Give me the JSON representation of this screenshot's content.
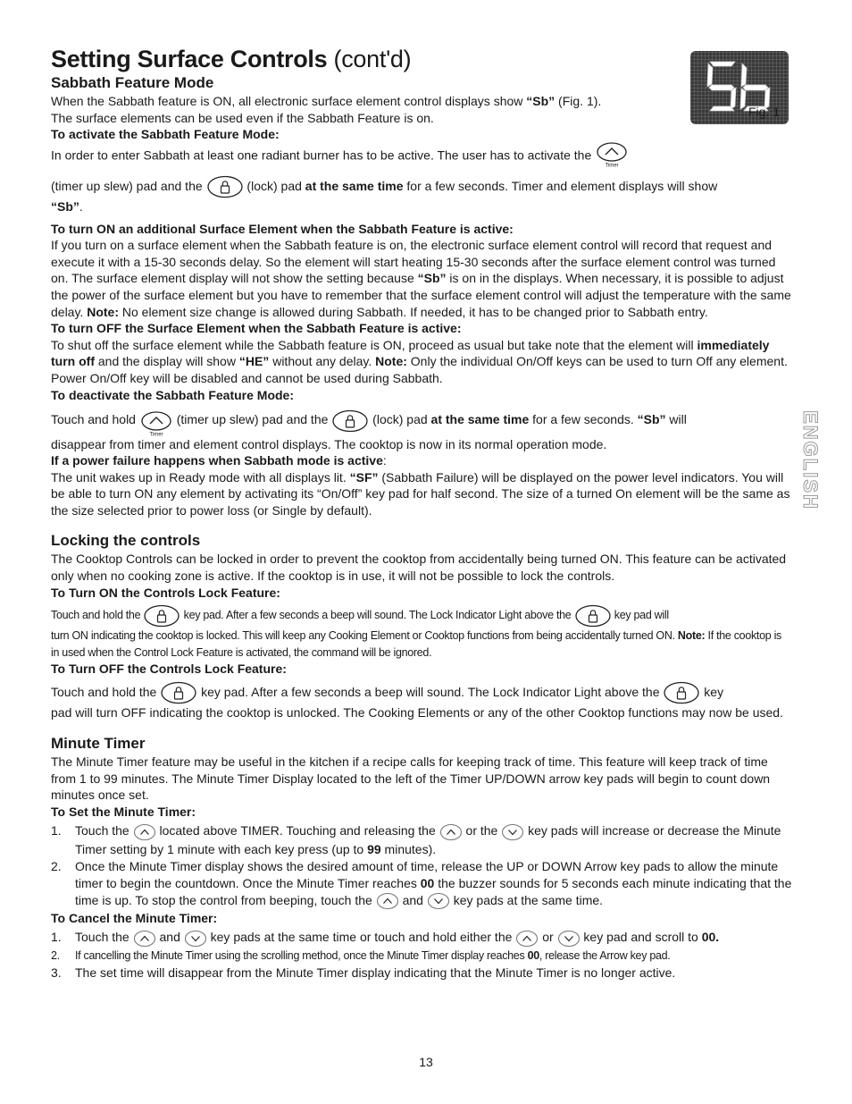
{
  "header": {
    "title_bold": "Setting Surface Controls",
    "title_light": " (cont'd)"
  },
  "figure": {
    "display_text": "Sb",
    "caption": "Fig. 1"
  },
  "side_tab": "ENGLISH",
  "icons": {
    "up": "up-arrow-pad",
    "down": "down-arrow-pad",
    "lock": "lock-pad",
    "timer_label": "Timer"
  },
  "sabbath": {
    "heading": "Sabbath Feature Mode",
    "intro1_a": "When the Sabbath feature is ON, all electronic surface element control displays show ",
    "intro1_b": "“Sb”",
    "intro1_c": " (Fig. 1).",
    "intro2": "The surface elements can be used even if the Sabbath Feature is on.",
    "activate_heading": "To activate the Sabbath Feature Mode:",
    "activate_p1": "In order to enter Sabbath at least one radiant burner has to be active. The user has to activate the",
    "activate_p2_a": "(timer up slew) pad and the",
    "activate_p2_b": "(lock) pad ",
    "activate_p2_bold": "at the same time",
    "activate_p2_c": " for a few seconds. Timer and element displays will show",
    "activate_p3": "“Sb”",
    "activate_p3_end": ".",
    "on_heading": "To turn ON an additional Surface Element when the Sabbath Feature is active:",
    "on_p1": "If you turn on a surface element when the Sabbath feature is on, the electronic surface element control will record that request and execute it with a 15-30 seconds delay. So the element will start heating 15-30 seconds after the surface element control was turned on. The surface element display will not show the setting because ",
    "on_p1_bold": "“Sb”",
    "on_p1_b": " is on in the displays. When necessary, it is possible to adjust the power of the surface element but you have to remember that the surface element control will adjust the temperature with the same delay. ",
    "on_note": "Note:",
    "on_p1_c": " No element size change is allowed during Sabbath. If needed, it has to be changed prior to Sabbath entry.",
    "off_heading": "To turn OFF the Surface Element when the Sabbath Feature is active:",
    "off_p1_a": "To shut off the surface element while the Sabbath feature is ON, proceed as usual but take note that the element will ",
    "off_p1_bold": "immediately turn off",
    "off_p1_b": " and the display will show ",
    "off_p1_he": "“HE”",
    "off_p1_c": " without any delay. ",
    "off_note": "Note:",
    "off_p1_d": " Only the individual On/Off keys can be used to turn Off any element. Power On/Off key will be disabled and cannot be used during Sabbath.",
    "deactivate_heading": "To deactivate the Sabbath Feature Mode:",
    "deact_a": "Touch and hold",
    "deact_b": "(timer up slew) pad and the",
    "deact_c": "(lock) pad ",
    "deact_bold": "at the same time",
    "deact_d": " for a few seconds. ",
    "deact_sb": "“Sb”",
    "deact_e": " will",
    "deact_p2": "disappear from timer and element control displays. The cooktop is now in its normal operation mode.",
    "power_heading": "If a power failure happens when Sabbath mode is active",
    "power_heading_colon": ":",
    "power_p_a": "The unit wakes up in Ready mode with all displays lit. ",
    "power_sf": "“SF”",
    "power_p_b": " (Sabbath Failure) will be displayed on the power level indicators. You will be able to turn ON any element by activating its “On/Off” key pad for half second. The size of a turned On element will be the same as the size selected prior to power loss (or Single by default)."
  },
  "locking": {
    "heading": "Locking the controls",
    "intro": "The Cooktop Controls can be locked in order to prevent the cooktop from accidentally being turned ON. This feature can be activated only when no cooking zone is active. If the cooktop is in use, it will not be possible to lock the controls.",
    "on_heading": "To Turn ON the Controls Lock Feature:",
    "on_a": "Touch and hold the",
    "on_b": "key pad. After a few seconds a beep will sound. The Lock Indicator Light above the",
    "on_c": "key pad will",
    "on_p2": "turn ON indicating the cooktop is locked. This will keep any Cooking Element or Cooktop functions from being accidentally turned ON. ",
    "on_note": "Note:",
    "on_p2_b": " If the cooktop is in used when the Control Lock Feature is activated, the command will be ignored.",
    "off_heading": "To Turn OFF the Controls Lock Feature:",
    "off_a": "Touch and hold the",
    "off_b": "key pad. After a few seconds a beep will sound. The Lock Indicator Light above the",
    "off_c": "key",
    "off_p2": "pad will  turn OFF indicating the cooktop is unlocked. The Cooking Elements or any of the other Cooktop functions may now be used."
  },
  "timer": {
    "heading": "Minute Timer",
    "intro": "The Minute Timer feature may be useful in the kitchen if a recipe calls for keeping track of time. This feature will keep track of time from 1 to 99 minutes. The Minute Timer Display located to the left of the Timer UP/DOWN arrow key pads will begin to count down minutes once set.",
    "set_heading": "To Set the Minute Timer:",
    "set_steps": [
      {
        "num": "1.",
        "a": "Touch the",
        "b": "located above TIMER. Touching and releasing the",
        "c": "or the",
        "d": "key pads will increase or decrease the Minute Timer setting by 1 minute with each key press (up to ",
        "bold": "99",
        "e": " minutes)."
      },
      {
        "num": "2.",
        "a": "Once the Minute Timer display shows the desired amount of time, release the UP or DOWN Arrow key pads to allow the minute timer to begin the countdown. Once the Minute Timer reaches ",
        "bold1": "00",
        "b": " the buzzer sounds for 5 seconds each minute indicating that the time is up. To stop the control from beeping, touch the",
        "c": "and",
        "d": "key pads at the same time."
      }
    ],
    "cancel_heading": "To Cancel the Minute Timer:",
    "cancel_steps": [
      {
        "num": "1.",
        "a": "Touch the",
        "b": "and",
        "c": "key pads at the same time or touch and hold either the",
        "d": "or",
        "e": "key pad and scroll to ",
        "bold": "00."
      },
      {
        "num": "2.",
        "a": "If cancelling the Minute Timer using the scrolling method, once the Minute Timer display reaches ",
        "bold": "00",
        "b": ", release the Arrow key pad."
      },
      {
        "num": "3.",
        "a": "The set time will disappear from the Minute Timer display indicating that the Minute Timer is no longer active."
      }
    ]
  },
  "page_number": "13"
}
